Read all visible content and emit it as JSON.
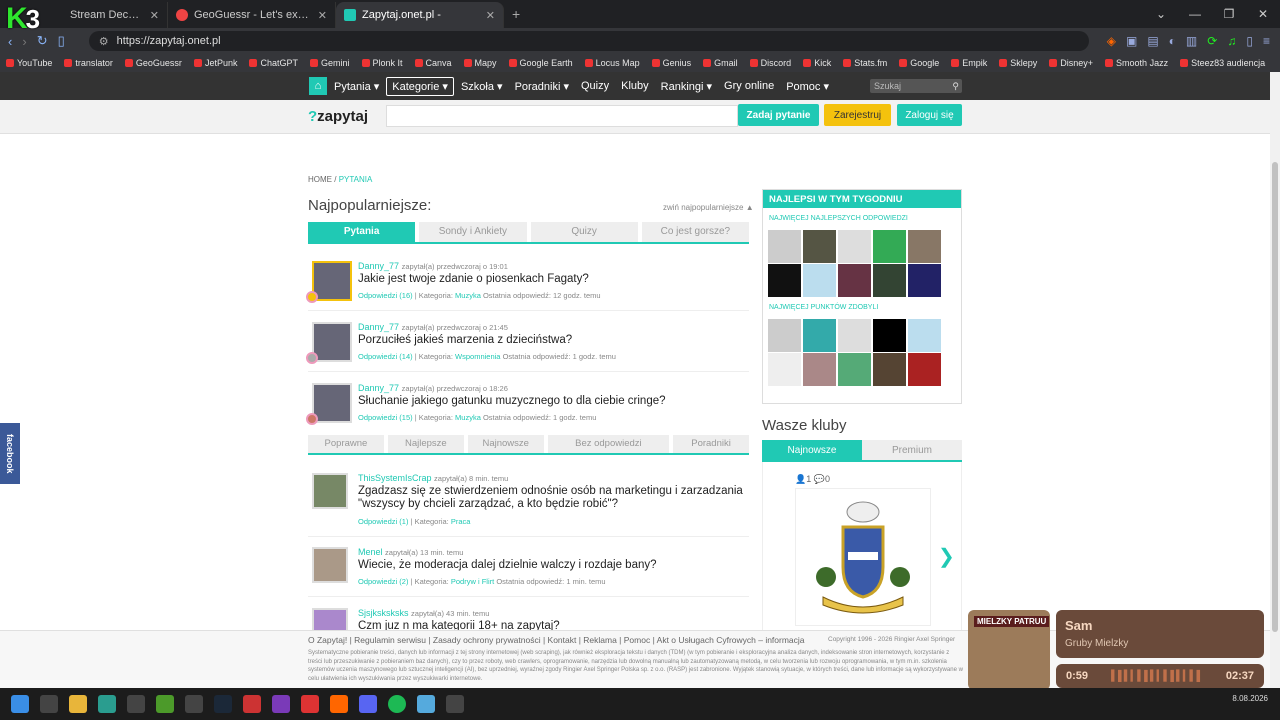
{
  "browser": {
    "tabs": [
      {
        "title": "Stream Deck Dashboard"
      },
      {
        "title": "GeoGuessr - Let's explore the world!"
      },
      {
        "title": "Zapytaj.onet.pl -"
      }
    ],
    "url": "https://zapytaj.onet.pl",
    "bookmarks": [
      "YouTube",
      "translator",
      "GeoGuessr",
      "JetPunk",
      "ChatGPT",
      "Gemini",
      "Plonk It",
      "Canva",
      "Mapy",
      "Google Earth",
      "Locus Map",
      "Genius",
      "Gmail",
      "Discord",
      "Kick",
      "Stats.fm",
      "Google",
      "Empik",
      "Sklepy",
      "Disney+",
      "Smooth Jazz",
      "Steez83 audiencja"
    ]
  },
  "overlay_logo": {
    "main": "K",
    "num": "3"
  },
  "site": {
    "nav": [
      {
        "label": "Pytania"
      },
      {
        "label": "Kategorie"
      },
      {
        "label": "Szkoła"
      },
      {
        "label": "Poradniki"
      },
      {
        "label": "Quizy"
      },
      {
        "label": "Kluby"
      },
      {
        "label": "Rankingi"
      },
      {
        "label": "Gry online"
      },
      {
        "label": "Pomoc"
      }
    ],
    "search_placeholder": "Szukaj",
    "brand_q": "?",
    "brand": "zapytaj",
    "ask_button": "Zadaj pytanie",
    "register_button": "Zarejestruj",
    "login_button": "Zaloguj się"
  },
  "breadcrumb": {
    "home": "HOME",
    "sep": "/",
    "current": "PYTANIA"
  },
  "popular": {
    "title": "Najpopularniejsze:",
    "collapse": "zwiń najpopularniejsze ▲",
    "tabs": [
      "Pytania",
      "Sondy i Ankiety",
      "Quizy",
      "Co jest gorsze?"
    ],
    "items": [
      {
        "user": "Danny_77",
        "meta": "zapytał(a) przedwczoraj o 19:01",
        "title": "Jakie jest twoje zdanie o piosenkach Fagaty?",
        "answers": "Odpowiedzi (16)",
        "category_label": "Kategoria:",
        "category": "Muzyka",
        "last": "Ostatnia odpowiedź: 12 godz. temu"
      },
      {
        "user": "Danny_77",
        "meta": "zapytał(a) przedwczoraj o 21:45",
        "title": "Porzuciłeś jakieś marzenia z dzieciństwa?",
        "answers": "Odpowiedzi (14)",
        "category_label": "Kategoria:",
        "category": "Wspomnienia",
        "last": "Ostatnia odpowiedź: 1 godz. temu"
      },
      {
        "user": "Danny_77",
        "meta": "zapytał(a) przedwczoraj o 18:26",
        "title": "Słuchanie jakiego gatunku muzycznego to dla ciebie cringe?",
        "answers": "Odpowiedzi (15)",
        "category_label": "Kategoria:",
        "category": "Muzyka",
        "last": "Ostatnia odpowiedź: 1 godz. temu"
      }
    ]
  },
  "list": {
    "tabs": [
      "Poprawne",
      "Najlepsze",
      "Najnowsze",
      "Bez odpowiedzi",
      "Poradniki"
    ],
    "items": [
      {
        "user": "ThisSystemIsCrap",
        "meta": "zapytał(a) 8 min. temu",
        "title": "Zgadzasz się ze stwierdzeniem odnośnie osób na marketingu i zarzadzania \"wszyscy by chcieli zarządzać, a kto będzie robić\"?",
        "answers": "Odpowiedzi (1)",
        "category_label": "Kategoria:",
        "category": "Praca",
        "last": ""
      },
      {
        "user": "Menel",
        "meta": "zapytał(a) 13 min. temu",
        "title": "Wiecie, że moderacja dalej dzielnie walczy i rozdaje bany?",
        "answers": "Odpowiedzi (2)",
        "category_label": "Kategoria:",
        "category": "Podryw i Flirt",
        "last": "Ostatnia odpowiedź: 1 min. temu"
      },
      {
        "user": "Sjsjksksksks",
        "meta": "zapytał(a) 43 min. temu",
        "title": "Czm juz n ma kategorii 18+ na zapytaj?",
        "answers": "",
        "category_label": "",
        "category": "",
        "last": ""
      }
    ]
  },
  "best": {
    "title": "NAJLEPSI W TYM TYGODNIU",
    "sub1": "NAJWIĘCEJ NAJLEPSZYCH ODPOWIEDZI",
    "sub2": "NAJWIĘCEJ PUNKTÓW ZDOBYLI"
  },
  "clubs": {
    "title": "Wasze kluby",
    "tabs": [
      "Najnowsze",
      "Premium"
    ],
    "members": "1",
    "posts": "0"
  },
  "facebook": "facebook",
  "footer": {
    "links": "O Zapytaj! | Regulamin serwisu | Zasady ochrony prywatności | Kontakt | Reklama | Pomoc | Akt o Usługach Cyfrowych – informacja",
    "copyright": "Copyright 1996 - 2026 Ringier Axel Springer",
    "legal": "Systematyczne pobieranie treści, danych lub informacji z tej strony internetowej (web scraping), jak również eksploracja tekstu i danych (TDM) (w tym pobieranie i eksploracyjna analiza danych, indeksowanie stron internetowych, korzystanie z treści lub przeszukiwanie z pobieraniem baz danych), czy to przez roboty, web crawlers, oprogramowanie, narzędzia lub dowolną manualną lub zautomatyzowaną metodą, w celu tworzenia lub rozwoju oprogramowania, w tym m.in. szkolenia systemów uczenia maszynowego lub sztucznej inteligencji (AI), bez uprzedniej, wyraźnej zgody Ringier Axel Springer Polska sp. z o.o. (RASP) jest zabronione. Wyjątek stanowią sytuacje, w których treści, dane lub informacje są wykorzystywane w celu ułatwienia ich wyszukiwania przez wyszukiwarki internetowe."
  },
  "media": {
    "sign": "MIELZKY PATRUU",
    "title": "Sam",
    "artist": "Gruby Mielzky",
    "elapsed": "0:59",
    "total": "02:37"
  },
  "taskbar": {
    "date": "8.08.2026"
  }
}
